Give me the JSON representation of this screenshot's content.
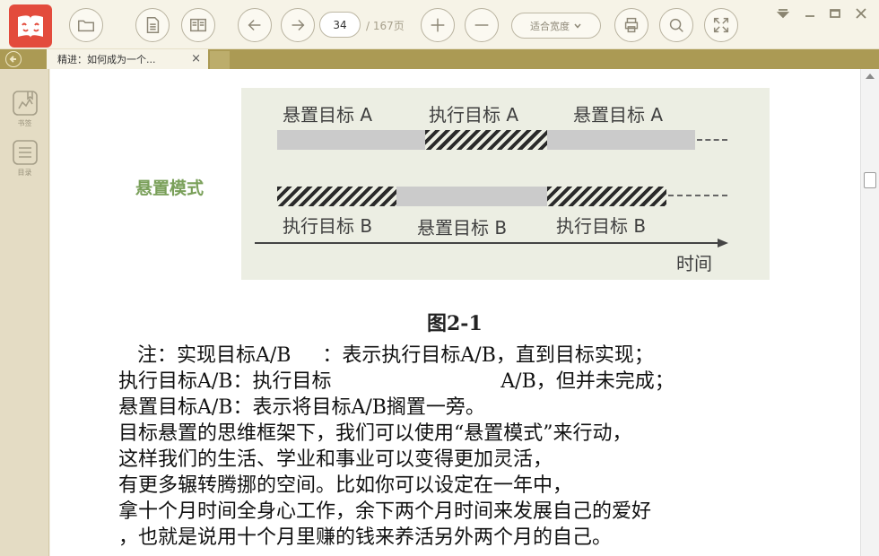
{
  "toolbar": {
    "page_current": "34",
    "page_total": "/ 167页",
    "zoom_mode": "适合宽度"
  },
  "tabs": [
    {
      "label": "精进：如何成为一个...",
      "close": "×"
    }
  ],
  "sidebar": {
    "items": [
      {
        "label": "书签",
        "icon": "bookmark-icon"
      },
      {
        "label": "目录",
        "icon": "toc-icon"
      }
    ]
  },
  "figure": {
    "top_labels": [
      "悬置目标 A",
      "执行目标 A",
      "悬置目标 A"
    ],
    "bottom_labels": [
      "执行目标 B",
      "悬置目标 B",
      "执行目标 B"
    ],
    "mode_label": "悬置模式",
    "time_label": "时间",
    "caption": "图2-1"
  },
  "paragraphs": [
    "   注：实现目标A/B     ：表示执行目标A/B，直到目标实现；",
    "执行目标A/B：执行目标                           A/B，但并未完成；",
    "悬置目标A/B：表示将目标A/B搁置一旁。",
    "目标悬置的思维框架下，我们可以使用“悬置模式”来行动，",
    "这样我们的生活、学业和事业可以变得更加灵活，",
    "有更多辗转腾挪的空间。比如你可以设定在一年中，",
    "拿十个月时间全身心工作，余下两个月时间来发展自己的爱好",
    "，也就是说用十个月里赚的钱来养活另外两个月的自己。"
  ],
  "colors": {
    "accent_tab_bar": "#ab9a54",
    "logo": "#e34b3c",
    "mode_label": "#7aa05a"
  }
}
